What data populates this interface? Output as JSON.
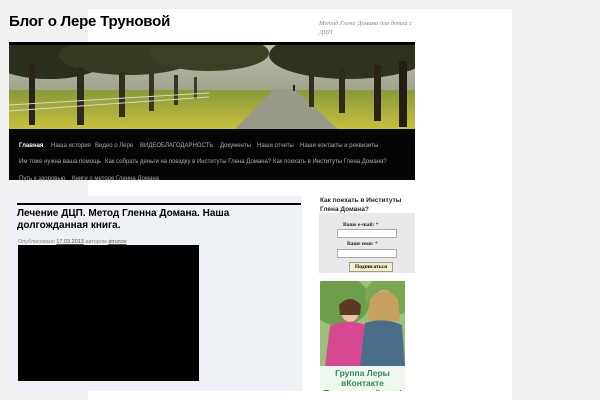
{
  "site": {
    "title": "Блог о Лере Труновой",
    "description": "Метод Глена Домана для детей с ДЦП"
  },
  "nav": {
    "row1": [
      "Главная",
      "Наша история",
      "Видео о Лере",
      "ВИДЕОБЛАГОДАРНОСТЬ",
      "Документы",
      "Наши отчеты",
      "Наши контакты и реквизиты"
    ],
    "row2": [
      "Им тоже нужна ваша помощь",
      "Как собрать деньги на поездку в Институты Глена Домана?",
      "Как поехать в Институты Глена Домана?"
    ],
    "row3": [
      "Путь к здоровью",
      "Книги о методе Гленна Домана"
    ],
    "active": "Главная"
  },
  "post": {
    "title": "Лечение ДЦП. Метод Гленна Домана. Наша долгожданная книга.",
    "meta_prefix": "Опубликовано",
    "date": "17.03.2013",
    "meta_author_prefix": "автором",
    "author": "atrunov"
  },
  "sidebar": {
    "widget_title": "Как поехать в Институты Глена Домана?",
    "email_label": "Ваше e-mail:",
    "name_label": "Ваше имя:",
    "required_mark": "*",
    "subscribe_button": "Подписаться",
    "promo_text": "Группа Леры вКонтакте Присоединяйтесь!"
  },
  "colors": {
    "nav_bg": "#050505",
    "promo_text": "#2e8b57",
    "content_bg": "#eef2f7"
  }
}
